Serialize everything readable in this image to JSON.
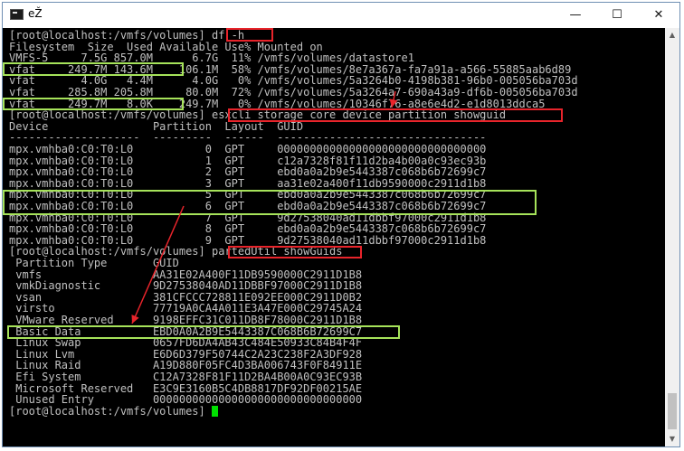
{
  "window": {
    "title": "eŽ",
    "minimize_icon": "minimize-icon",
    "maximize_icon": "maximize-icon",
    "close_icon": "close-icon",
    "minimize_glyph": "—",
    "maximize_glyph": "☐",
    "close_glyph": "✕"
  },
  "terminal": {
    "lines": [
      "[root@localhost:/vmfs/volumes] df -h",
      "Filesystem  Size  Used Available Use% Mounted on",
      "VMFS-5     7.5G 857.0M      6.7G  11% /vmfs/volumes/datastore1",
      "vfat     249.7M 143.6M    106.1M  58% /vmfs/volumes/8e7a367a-fa7a91a-a566-55885aab6d89",
      "vfat       4.0G   4.4M      4.0G   0% /vmfs/volumes/5a3264b0-4198b381-96b0-005056ba703d",
      "vfat     285.8M 205.8M     80.0M  72% /vmfs/volumes/5a3264a7-690a43a9-df6b-005056ba703d",
      "vfat     249.7M   8.0K    249.7M   0% /vmfs/volumes/10346f76-a8e6e4d2-e1d8013ddca5",
      "[root@localhost:/vmfs/volumes] esxcli storage core device partition showguid",
      "Device                Partition  Layout  GUID",
      "--------------------  ---------  ------  --------------------------------",
      "mpx.vmhba0:C0:T0:L0           0  GPT     00000000000000000000000000000000",
      "mpx.vmhba0:C0:T0:L0           1  GPT     c12a7328f81f11d2ba4b00a0c93ec93b",
      "mpx.vmhba0:C0:T0:L0           2  GPT     ebd0a0a2b9e5443387c068b6b72699c7",
      "mpx.vmhba0:C0:T0:L0           3  GPT     aa31e02a400f11db9590000c2911d1b8",
      "mpx.vmhba0:C0:T0:L0           5  GPT     ebd0a0a2b9e5443387c068b6b72699c7",
      "mpx.vmhba0:C0:T0:L0           6  GPT     ebd0a0a2b9e5443387c068b6b72699c7",
      "mpx.vmhba0:C0:T0:L0           7  GPT     9d27538040ad11dbbf97000c2911d1b8",
      "mpx.vmhba0:C0:T0:L0           8  GPT     ebd0a0a2b9e5443387c068b6b72699c7",
      "mpx.vmhba0:C0:T0:L0           9  GPT     9d27538040ad11dbbf97000c2911d1b8",
      "[root@localhost:/vmfs/volumes] partedUtil showGuids",
      " Partition Type       GUID",
      " vmfs                 AA31E02A400F11DB9590000C2911D1B8",
      " vmkDiagnostic        9D27538040AD11DBBF97000C2911D1B8",
      " vsan                 381CFCCC728811E092EE000C2911D0B2",
      " virsto               77719A0CA4A011E3A47E000C29745A24",
      " VMware Reserved      9198EFFC31C011DB8F78000C2911D1B8",
      " Basic Data           EBD0A0A2B9E5443387C068B6B72699C7",
      " Linux Swap           0657FD6DA4AB43C484E50933C84B4F4F",
      " Linux Lvm            E6D6D379F50744C2A23C238F2A3DF928",
      " Linux Raid           A19D880F05FC4D3BA006743F0F84911E",
      " Efi System           C12A7328F81F11D2BA4B00A0C93EC93B",
      " Microsoft Reserved   E3C9E3160B5C4DB8817DF92DF00215AE",
      " Unused Entry         00000000000000000000000000000000",
      "[root@localhost:/vmfs/volumes] "
    ]
  },
  "scrollbar": {
    "up_icon": "scroll-up-arrow-icon",
    "down_icon": "scroll-down-arrow-icon",
    "up_glyph": "▲",
    "down_glyph": "▼"
  },
  "annotations": {
    "highlight_red": "#e8242b",
    "highlight_green": "#a6e35a",
    "cursor_color": "#00e000",
    "terminal_bg": "#000000",
    "terminal_fg": "#c0c0c0"
  }
}
